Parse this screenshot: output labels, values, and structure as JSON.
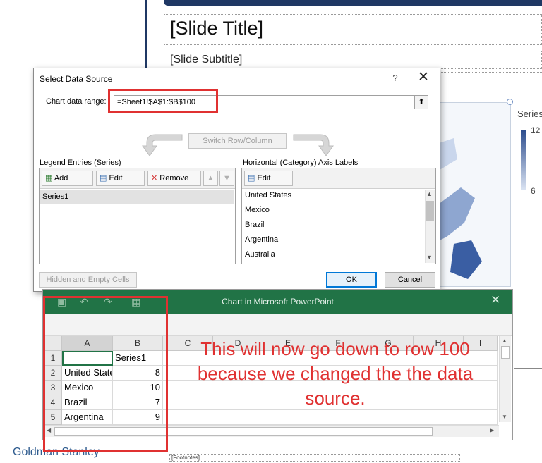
{
  "slide": {
    "title": "[Slide Title]",
    "subtitle": "[Slide Subtitle]",
    "footnotes": "[Footnotes]",
    "brand": "Goldman Stanley",
    "legend": {
      "title": "Series",
      "max": "12",
      "min": "6"
    }
  },
  "dialog": {
    "title": "Select Data Source",
    "help": "?",
    "close": "✕",
    "range_label": "Chart data range:",
    "range_value": "=Sheet1!$A$1:$B$100",
    "range_collapse": "⬆",
    "switch_label": "Switch Row/Column",
    "legend_entries_label": "Legend Entries (Series)",
    "axis_labels_label": "Horizontal (Category) Axis Labels",
    "legend_toolbar": {
      "add": "Add",
      "edit": "Edit",
      "remove": "Remove",
      "up": "▲",
      "down": "▼"
    },
    "series": [
      "Series1"
    ],
    "axis_toolbar": {
      "edit": "Edit"
    },
    "axis_items": [
      "United States",
      "Mexico",
      "Brazil",
      "Argentina",
      "Australia"
    ],
    "hidden_cells": "Hidden and Empty Cells",
    "ok": "OK",
    "cancel": "Cancel"
  },
  "excel": {
    "title": "Chart in Microsoft PowerPoint",
    "close": "✕",
    "columns": [
      "A",
      "B",
      "C",
      "D",
      "E",
      "F",
      "G",
      "H",
      "I"
    ],
    "rows": [
      {
        "num": "1",
        "a": "",
        "b": "Series1"
      },
      {
        "num": "2",
        "a": "United States",
        "b": "8"
      },
      {
        "num": "3",
        "a": "Mexico",
        "b": "10"
      },
      {
        "num": "4",
        "a": "Brazil",
        "b": "7"
      },
      {
        "num": "5",
        "a": "Argentina",
        "b": "9"
      }
    ]
  },
  "annotation": {
    "text": "This will now go down to row 100 because we changed the the data source.",
    "color": "#e03131"
  },
  "colors": {
    "excel_green": "#217346",
    "slide_navy": "#1f3864",
    "highlight_red": "#e03131"
  }
}
